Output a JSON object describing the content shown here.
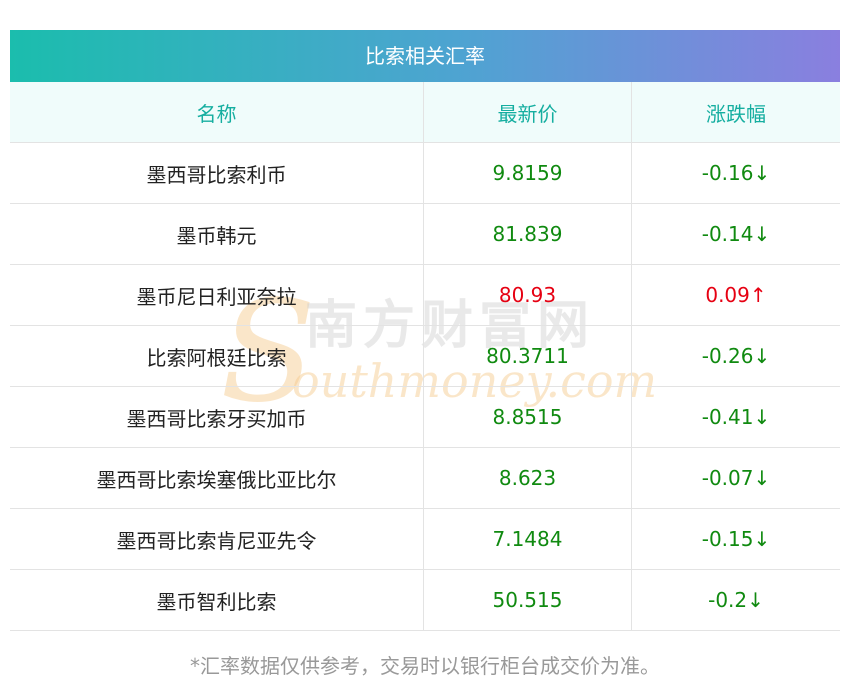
{
  "table": {
    "title": "比索相关汇率",
    "headers": [
      "名称",
      "最新价",
      "涨跌幅"
    ],
    "rows": [
      {
        "name": "墨西哥比索利币",
        "price": "9.8159",
        "change": "-0.16↓",
        "color": "#108a10"
      },
      {
        "name": "墨币韩元",
        "price": "81.839",
        "change": "-0.14↓",
        "color": "#108a10"
      },
      {
        "name": "墨币尼日利亚奈拉",
        "price": "80.93",
        "change": "0.09↑",
        "color": "#e60012"
      },
      {
        "name": "比索阿根廷比索",
        "price": "80.3711",
        "change": "-0.26↓",
        "color": "#108a10"
      },
      {
        "name": "墨西哥比索牙买加币",
        "price": "8.8515",
        "change": "-0.41↓",
        "color": "#108a10"
      },
      {
        "name": "墨西哥比索埃塞俄比亚比尔",
        "price": "8.623",
        "change": "-0.07↓",
        "color": "#108a10"
      },
      {
        "name": "墨西哥比索肯尼亚先令",
        "price": "7.1484",
        "change": "-0.15↓",
        "color": "#108a10"
      },
      {
        "name": "墨币智利比索",
        "price": "50.515",
        "change": "-0.2↓",
        "color": "#108a10"
      }
    ]
  },
  "watermark": {
    "cn": "南方财富网",
    "en": "outhmoney.com",
    "letter": "S"
  },
  "footnote": "*汇率数据仅供参考，交易时以银行柜台成交价为准。"
}
